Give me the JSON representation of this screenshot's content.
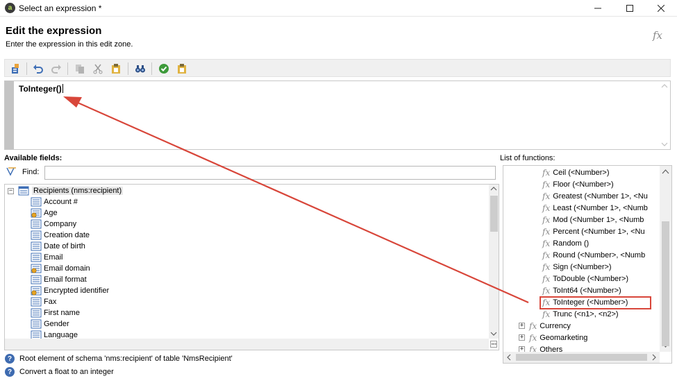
{
  "window": {
    "title": "Select an expression *"
  },
  "header": {
    "title": "Edit the expression",
    "subtitle": "Enter the expression in this edit zone.",
    "fx_icon": "fx"
  },
  "toolbar": {
    "icons": [
      "add-field-icon",
      "undo-icon",
      "redo-icon",
      "copy-icon",
      "cut-icon",
      "paste-icon",
      "find-binoculars-icon",
      "validate-check-icon",
      "paste-special-icon"
    ]
  },
  "editor": {
    "expression": "ToInteger()"
  },
  "fields": {
    "label": "Available fields:",
    "find_label": "Find:",
    "find_value": "",
    "root": "Recipients (nms:recipient)",
    "items": [
      {
        "label": "Account #",
        "icon": "field-icon"
      },
      {
        "label": "Age",
        "icon": "calculated-field-icon"
      },
      {
        "label": "Company",
        "icon": "field-icon"
      },
      {
        "label": "Creation date",
        "icon": "field-icon"
      },
      {
        "label": "Date of birth",
        "icon": "field-icon"
      },
      {
        "label": "Email",
        "icon": "field-icon"
      },
      {
        "label": "Email domain",
        "icon": "calculated-field-icon"
      },
      {
        "label": "Email format",
        "icon": "field-icon"
      },
      {
        "label": "Encrypted identifier",
        "icon": "calculated-field-icon"
      },
      {
        "label": "Fax",
        "icon": "field-icon"
      },
      {
        "label": "First name",
        "icon": "field-icon"
      },
      {
        "label": "Gender",
        "icon": "field-icon"
      },
      {
        "label": "Language",
        "icon": "field-icon"
      }
    ]
  },
  "functions": {
    "label": "List of functions:",
    "fx": "fx",
    "items": [
      "Ceil (<Number>)",
      "Floor (<Number>)",
      "Greatest (<Number 1>, <Nu",
      "Least (<Number 1>, <Numb",
      "Mod (<Number 1>, <Numb",
      "Percent (<Number 1>, <Nu",
      "Random ()",
      "Round (<Number>, <Numb",
      "Sign (<Number>)",
      "ToDouble (<Number>)",
      "ToInt64 (<Number>)",
      "ToInteger (<Number>)",
      "Trunc (<n1>, <n2>)"
    ],
    "selected": "ToInteger (<Number>)",
    "groups": [
      "Currency",
      "Geomarketing",
      "Others"
    ]
  },
  "status": {
    "line1": "Root element of schema 'nms:recipient' of table 'NmsRecipient'",
    "line2": "Convert a float to an integer"
  },
  "colors": {
    "annotation": "#d8463a",
    "selection_bg": "#e8e8e8"
  }
}
